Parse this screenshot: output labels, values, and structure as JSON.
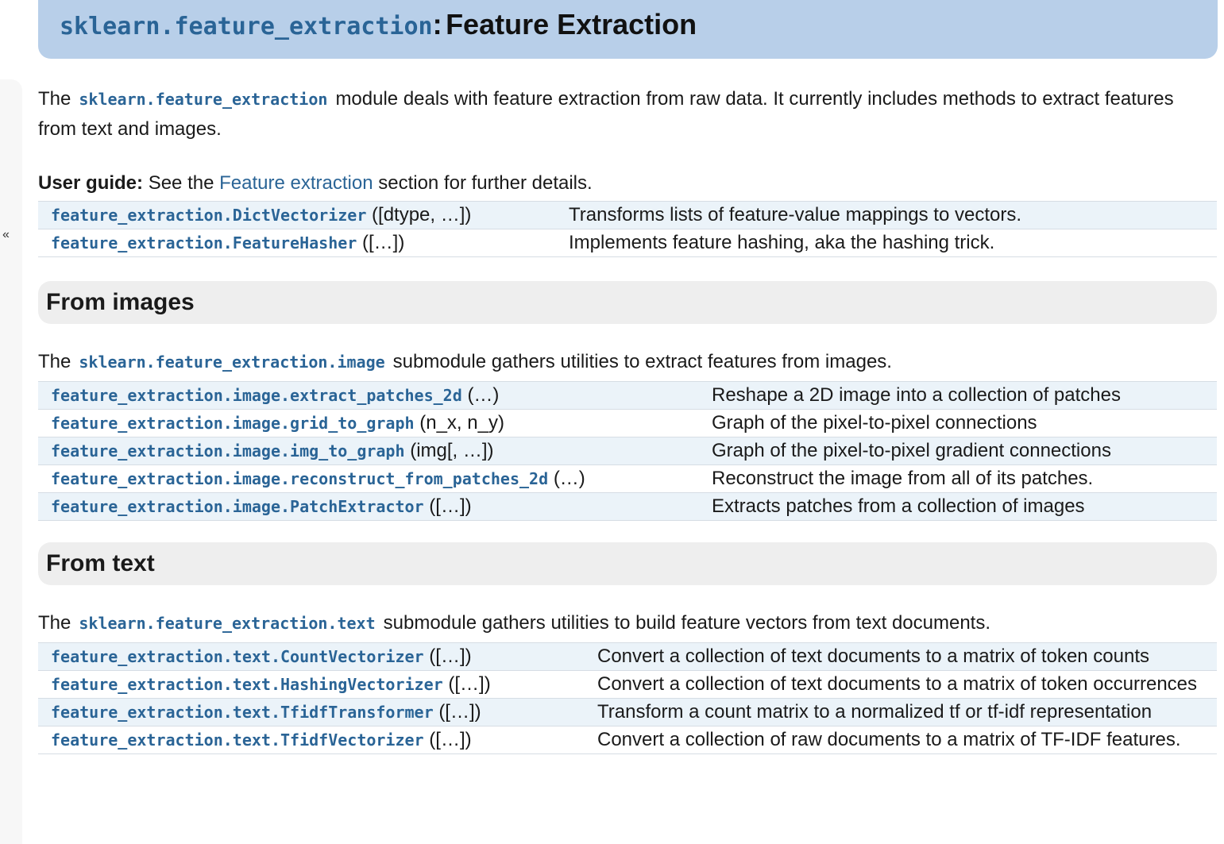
{
  "sidebar": {
    "collapse_label": "«"
  },
  "header": {
    "module": "sklearn.feature_extraction",
    "separator": ":",
    "title": "Feature Extraction"
  },
  "intro": {
    "prefix": "The",
    "module": "sklearn.feature_extraction",
    "text": "module deals with feature extraction from raw data. It currently includes methods to extract features from text and images."
  },
  "user_guide": {
    "label": "User guide:",
    "before": "See the",
    "link": "Feature extraction",
    "after": "section for further details."
  },
  "main_table": [
    {
      "name": "feature_extraction.DictVectorizer",
      "signature": "([dtype, …])",
      "description": "Transforms lists of feature-value mappings to vectors."
    },
    {
      "name": "feature_extraction.FeatureHasher",
      "signature": "([…])",
      "description": "Implements feature hashing, aka the hashing trick."
    }
  ],
  "images_section": {
    "title": "From images",
    "prefix": "The",
    "module": "sklearn.feature_extraction.image",
    "text": "submodule gathers utilities to extract features from images.",
    "rows": [
      {
        "name": "feature_extraction.image.extract_patches_2d",
        "signature": "(…)",
        "description": "Reshape a 2D image into a collection of patches"
      },
      {
        "name": "feature_extraction.image.grid_to_graph",
        "signature": "(n_x, n_y)",
        "description": "Graph of the pixel-to-pixel connections"
      },
      {
        "name": "feature_extraction.image.img_to_graph",
        "signature": "(img[, …])",
        "description": "Graph of the pixel-to-pixel gradient connections"
      },
      {
        "name": "feature_extraction.image.reconstruct_from_patches_2d",
        "signature": "(…)",
        "description": "Reconstruct the image from all of its patches."
      },
      {
        "name": "feature_extraction.image.PatchExtractor",
        "signature": "([…])",
        "description": "Extracts patches from a collection of images"
      }
    ]
  },
  "text_section": {
    "title": "From text",
    "prefix": "The",
    "module": "sklearn.feature_extraction.text",
    "text": "submodule gathers utilities to build feature vectors from text documents.",
    "rows": [
      {
        "name": "feature_extraction.text.CountVectorizer",
        "signature": "([…])",
        "description": "Convert a collection of text documents to a matrix of token counts"
      },
      {
        "name": "feature_extraction.text.HashingVectorizer",
        "signature": "([…])",
        "description": "Convert a collection of text documents to a matrix of token occurrences"
      },
      {
        "name": "feature_extraction.text.TfidfTransformer",
        "signature": "([…])",
        "description": "Transform a count matrix to a normalized tf or tf-idf representation"
      },
      {
        "name": "feature_extraction.text.TfidfVectorizer",
        "signature": "([…])",
        "description": "Convert a collection of raw documents to a matrix of TF-IDF features."
      }
    ]
  }
}
